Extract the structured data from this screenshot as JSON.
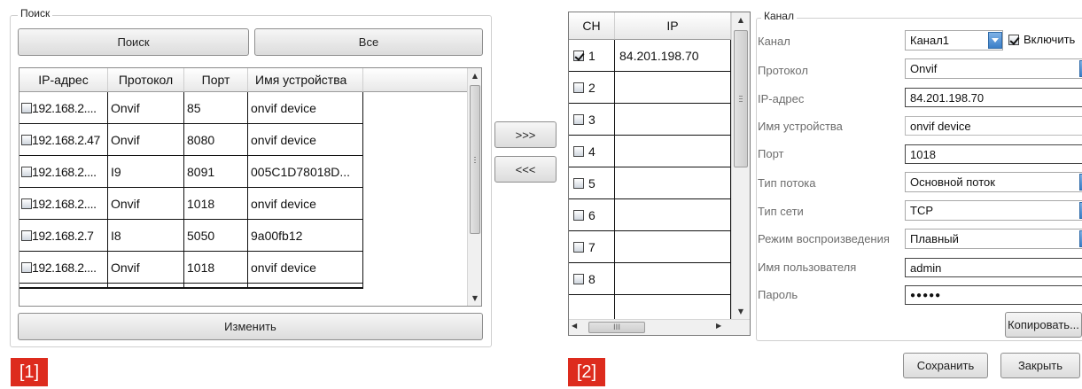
{
  "left_panel": {
    "group_title": "Поиск",
    "search_button": "Поиск",
    "all_button": "Все",
    "columns": [
      "IP-адрес",
      "Протокол",
      "Порт",
      "Имя устройства"
    ],
    "rows": [
      {
        "ip": "192.168.2....",
        "protocol": "Onvif",
        "port": "85",
        "name": "onvif device"
      },
      {
        "ip": "192.168.2.47",
        "protocol": "Onvif",
        "port": "8080",
        "name": "onvif device"
      },
      {
        "ip": "192.168.2....",
        "protocol": "I9",
        "port": "8091",
        "name": "005C1D78018D..."
      },
      {
        "ip": "192.168.2....",
        "protocol": "Onvif",
        "port": "1018",
        "name": "onvif device"
      },
      {
        "ip": "192.168.2.7",
        "protocol": "I8",
        "port": "5050",
        "name": "9a00fb12"
      },
      {
        "ip": "192.168.2....",
        "protocol": "Onvif",
        "port": "1018",
        "name": "onvif device"
      }
    ],
    "edit_button": "Изменить",
    "tag": "[1]"
  },
  "transfer": {
    "add_button": ">>>",
    "remove_button": "<<<"
  },
  "channel_list": {
    "columns": [
      "CH",
      "IP"
    ],
    "rows": [
      {
        "ch": "1",
        "ip": "84.201.198.70",
        "checked": true
      },
      {
        "ch": "2",
        "ip": "",
        "checked": false
      },
      {
        "ch": "3",
        "ip": "",
        "checked": false
      },
      {
        "ch": "4",
        "ip": "",
        "checked": false
      },
      {
        "ch": "5",
        "ip": "",
        "checked": false
      },
      {
        "ch": "6",
        "ip": "",
        "checked": false
      },
      {
        "ch": "7",
        "ip": "",
        "checked": false
      },
      {
        "ch": "8",
        "ip": "",
        "checked": false
      }
    ],
    "hscroll_glyph": "III",
    "tag": "[2]"
  },
  "channel_form": {
    "group_title": "Канал",
    "labels": {
      "channel": "Канал",
      "protocol": "Протокол",
      "ip": "IP-адрес",
      "device_name": "Имя устройства",
      "port": "Порт",
      "stream_type": "Тип потока",
      "network_type": "Тип сети",
      "playback_mode": "Режим воспроизведения",
      "username": "Имя пользователя",
      "password": "Пароль"
    },
    "values": {
      "channel": "Канал1",
      "enable": "Включить",
      "protocol": "Onvif",
      "ip": "84.201.198.70",
      "device_name": "onvif device",
      "port": "1018",
      "stream_type": "Основной поток",
      "network_type": "TCP",
      "playback_mode": "Плавный",
      "username": "admin",
      "password": "●●●●●"
    },
    "copy_button": "Копировать...",
    "save_button": "Сохранить",
    "close_button": "Закрыть"
  },
  "colors": {
    "tag_red": "#dd2b1d",
    "combo_blue": "#3a7ec8"
  }
}
